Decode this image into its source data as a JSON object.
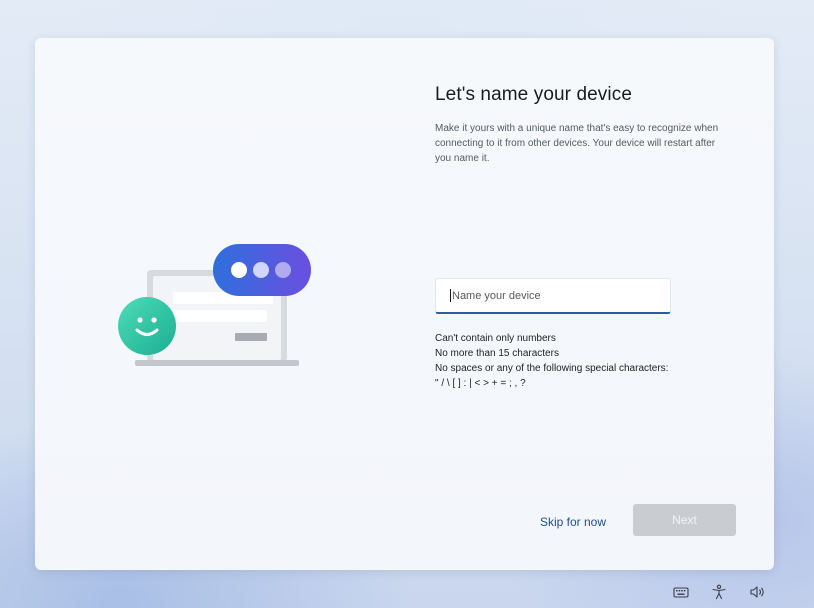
{
  "page": {
    "title": "Let's name your device",
    "description": "Make it yours with a unique name that's easy to recognize when connecting to it from other devices. Your device will restart after you name it."
  },
  "device_name_input": {
    "value": "",
    "placeholder": "Name your device"
  },
  "rules": [
    "Can't contain only numbers",
    "No more than 15 characters",
    "No spaces or any of the following special characters:",
    "\" / \\ [ ] : | < > + = ; , ?"
  ],
  "actions": {
    "skip_label": "Skip for now",
    "next_label": "Next"
  },
  "taskbar": {
    "icons": [
      "keyboard-icon",
      "accessibility-icon",
      "volume-icon"
    ]
  },
  "colors": {
    "accent": "#2b5aa8",
    "link": "#1d4f91",
    "disabled_button": "#c9cdd2",
    "bubble_gradient": [
      "#2f6fdc",
      "#6a4fe0"
    ],
    "smiley_gradient": [
      "#46d6b0",
      "#1fb597"
    ]
  }
}
